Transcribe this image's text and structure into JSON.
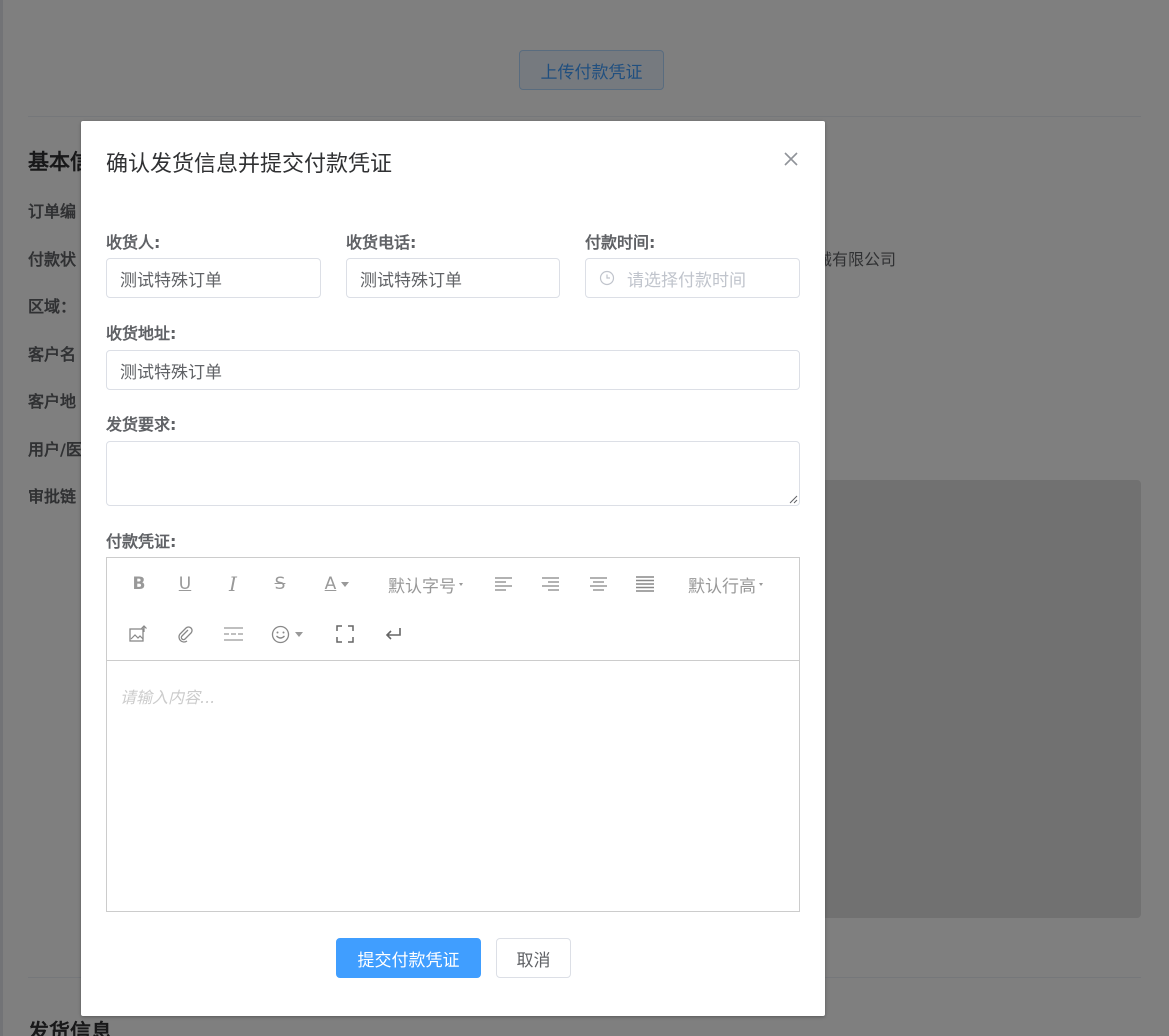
{
  "background": {
    "upload_button": "上传付款凭证",
    "section_basic": "基本信",
    "section_shipping": "发货信息",
    "labels": [
      "订单编",
      "付款状",
      "区域：",
      "客户名",
      "客户地",
      "用户/医",
      "审批链"
    ],
    "company_value": "械有限公司"
  },
  "dialog": {
    "title": "确认发货信息并提交付款凭证",
    "close_icon": "close-icon",
    "fields": {
      "receiver": {
        "label": "收货人:",
        "value": "测试特殊订单"
      },
      "phone": {
        "label": "收货电话:",
        "value": "测试特殊订单"
      },
      "pay_time": {
        "label": "付款时间:",
        "placeholder": "请选择付款时间"
      },
      "address": {
        "label": "收货地址:",
        "value": "测试特殊订单"
      },
      "shipping_req": {
        "label": "发货要求:",
        "value": ""
      },
      "voucher": {
        "label": "付款凭证:"
      }
    },
    "editor": {
      "toolbar": {
        "bold": "B",
        "underline": "U",
        "italic": "I",
        "strike": "S",
        "font_color": "A",
        "font_size": "默认字号",
        "line_height": "默认行高"
      },
      "icons": [
        "bold-icon",
        "underline-icon",
        "italic-icon",
        "strikethrough-icon",
        "font-color-icon",
        "align-left-icon",
        "align-right-icon",
        "align-center-icon",
        "align-justify-icon",
        "image-upload-icon",
        "attachment-icon",
        "divider-icon",
        "emoji-icon",
        "fullscreen-icon",
        "line-break-icon"
      ],
      "placeholder": "请输入内容..."
    },
    "buttons": {
      "submit": "提交付款凭证",
      "cancel": "取消"
    }
  },
  "colors": {
    "primary": "#409eff",
    "overlay": "rgba(0,0,0,0.5)"
  }
}
